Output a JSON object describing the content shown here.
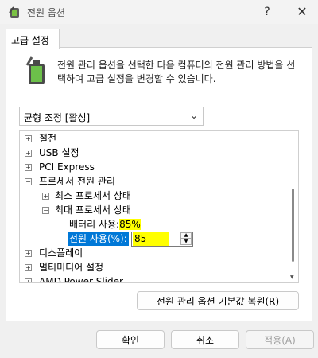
{
  "window": {
    "title": "전원 옵션",
    "help_icon": "?",
    "close_icon": "✕"
  },
  "tabs": [
    {
      "label": "고급 설정"
    }
  ],
  "description": "전원 관리 옵션을 선택한 다음 컴퓨터의 전원 관리 방법을 선택하여 고급 설정을 변경할 수 있습니다.",
  "plan_dropdown": {
    "selected": "균형 조정 [활성]",
    "chevron": "⌄"
  },
  "tree": {
    "items": [
      {
        "label": "절전",
        "expander": "+"
      },
      {
        "label": "USB 설정",
        "expander": "+"
      },
      {
        "label": "PCI Express",
        "expander": "+"
      },
      {
        "label": "프로세서 전원 관리",
        "expander": "−"
      },
      {
        "label": "최소 프로세서 상태",
        "expander": "+"
      },
      {
        "label": "최대 프로세서 상태",
        "expander": "−"
      },
      {
        "label": "디스플레이",
        "expander": "+"
      },
      {
        "label": "멀티미디어 설정",
        "expander": "+"
      },
      {
        "label": "AMD Power Slider",
        "expander": "+"
      }
    ],
    "battery_setting": {
      "label": "배터리 사용:",
      "value": "85%"
    },
    "plugged_setting": {
      "label": "전원 사용(%):",
      "value": "85"
    }
  },
  "buttons": {
    "restore_defaults": "전원 관리 옵션 기본값 복원(R)",
    "ok": "확인",
    "cancel": "취소",
    "apply": "적용(A)"
  }
}
